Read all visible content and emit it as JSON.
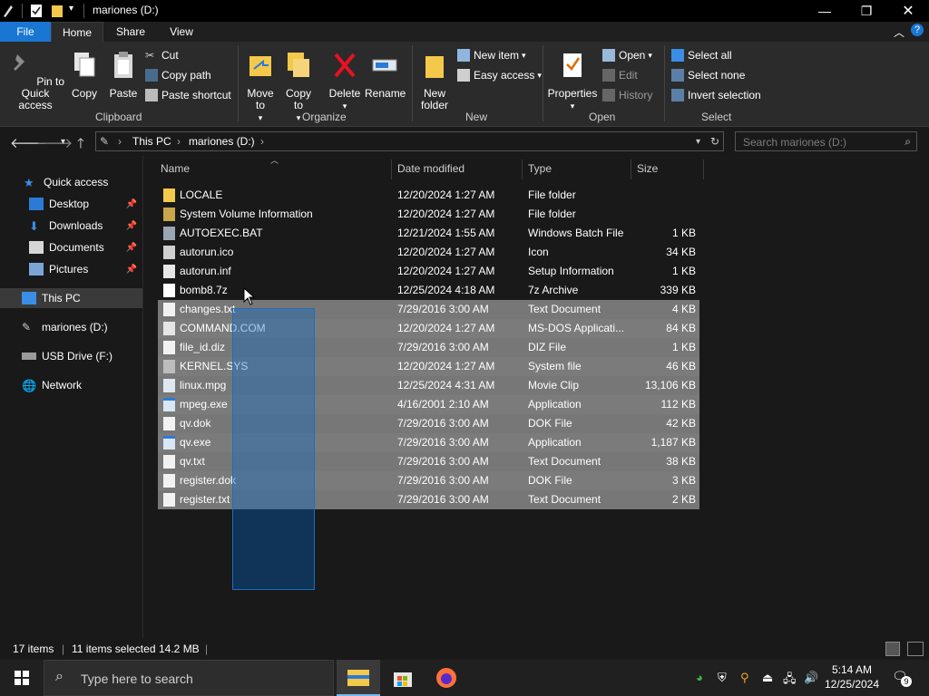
{
  "window": {
    "title": "mariones (D:)"
  },
  "ribbon_tabs": [
    "File",
    "Home",
    "Share",
    "View"
  ],
  "ribbon": {
    "clipboard": {
      "pin": "Pin to Quick access",
      "copy": "Copy",
      "paste": "Paste",
      "cut": "Cut",
      "copy_path": "Copy path",
      "paste_shortcut": "Paste shortcut",
      "label": "Clipboard"
    },
    "organize": {
      "move_to": "Move to",
      "copy_to": "Copy to",
      "delete": "Delete",
      "rename": "Rename",
      "label": "Organize"
    },
    "new": {
      "new_folder": "New folder",
      "new_item": "New item",
      "easy_access": "Easy access",
      "label": "New"
    },
    "open": {
      "properties": "Properties",
      "open": "Open",
      "edit": "Edit",
      "history": "History",
      "label": "Open"
    },
    "select": {
      "select_all": "Select all",
      "select_none": "Select none",
      "invert": "Invert selection",
      "label": "Select"
    }
  },
  "address": {
    "segments": [
      "This PC",
      "mariones (D:)"
    ],
    "search_placeholder": "Search mariones (D:)"
  },
  "nav_pane": {
    "quick_access": "Quick access",
    "items": [
      "Desktop",
      "Downloads",
      "Documents",
      "Pictures"
    ],
    "this_pc": "This PC",
    "drive": "mariones (D:)",
    "usb": "USB Drive (F:)",
    "network": "Network"
  },
  "columns": [
    "Name",
    "Date modified",
    "Type",
    "Size"
  ],
  "files": [
    {
      "name": "LOCALE",
      "date": "12/20/2024 1:27 AM",
      "type": "File folder",
      "size": "",
      "selected": false,
      "icon": "folder"
    },
    {
      "name": "System Volume Information",
      "date": "12/20/2024 1:27 AM",
      "type": "File folder",
      "size": "",
      "selected": false,
      "icon": "folder-system"
    },
    {
      "name": "AUTOEXEC.BAT",
      "date": "12/21/2024 1:55 AM",
      "type": "Windows Batch File",
      "size": "1 KB",
      "selected": false,
      "icon": "batch"
    },
    {
      "name": "autorun.ico",
      "date": "12/20/2024 1:27 AM",
      "type": "Icon",
      "size": "34 KB",
      "selected": false,
      "icon": "ico"
    },
    {
      "name": "autorun.inf",
      "date": "12/20/2024 1:27 AM",
      "type": "Setup Information",
      "size": "1 KB",
      "selected": false,
      "icon": "inf"
    },
    {
      "name": "bomb8.7z",
      "date": "12/25/2024 4:18 AM",
      "type": "7z Archive",
      "size": "339 KB",
      "selected": false,
      "icon": "7z"
    },
    {
      "name": "changes.txt",
      "date": "7/29/2016 3:00 AM",
      "type": "Text Document",
      "size": "4 KB",
      "selected": true,
      "icon": "txt"
    },
    {
      "name": "COMMAND.COM",
      "date": "12/20/2024 1:27 AM",
      "type": "MS-DOS Applicati...",
      "size": "84 KB",
      "selected": true,
      "icon": "com"
    },
    {
      "name": "file_id.diz",
      "date": "7/29/2016 3:00 AM",
      "type": "DIZ File",
      "size": "1 KB",
      "selected": true,
      "icon": "file"
    },
    {
      "name": "KERNEL.SYS",
      "date": "12/20/2024 1:27 AM",
      "type": "System file",
      "size": "46 KB",
      "selected": true,
      "icon": "sys"
    },
    {
      "name": "linux.mpg",
      "date": "12/25/2024 4:31 AM",
      "type": "Movie Clip",
      "size": "13,106 KB",
      "selected": true,
      "icon": "mpg"
    },
    {
      "name": "mpeg.exe",
      "date": "4/16/2001 2:10 AM",
      "type": "Application",
      "size": "112 KB",
      "selected": true,
      "icon": "exe"
    },
    {
      "name": "qv.dok",
      "date": "7/29/2016 3:00 AM",
      "type": "DOK File",
      "size": "42 KB",
      "selected": true,
      "icon": "file"
    },
    {
      "name": "qv.exe",
      "date": "7/29/2016 3:00 AM",
      "type": "Application",
      "size": "1,187 KB",
      "selected": true,
      "icon": "exe"
    },
    {
      "name": "qv.txt",
      "date": "7/29/2016 3:00 AM",
      "type": "Text Document",
      "size": "38 KB",
      "selected": true,
      "icon": "txt"
    },
    {
      "name": "register.dok",
      "date": "7/29/2016 3:00 AM",
      "type": "DOK File",
      "size": "3 KB",
      "selected": true,
      "icon": "file"
    },
    {
      "name": "register.txt",
      "date": "7/29/2016 3:00 AM",
      "type": "Text Document",
      "size": "2 KB",
      "selected": true,
      "icon": "txt"
    }
  ],
  "status": {
    "count": "17 items",
    "selected": "11 items selected",
    "size": "14.2 MB"
  },
  "taskbar": {
    "search_placeholder": "Type here to search",
    "time": "5:14 AM",
    "date": "12/25/2024",
    "notification_count": "9"
  },
  "colors": {
    "accent": "#1976d2",
    "folder": "#f3c84b",
    "selection": "#777777",
    "background": "#191919"
  }
}
